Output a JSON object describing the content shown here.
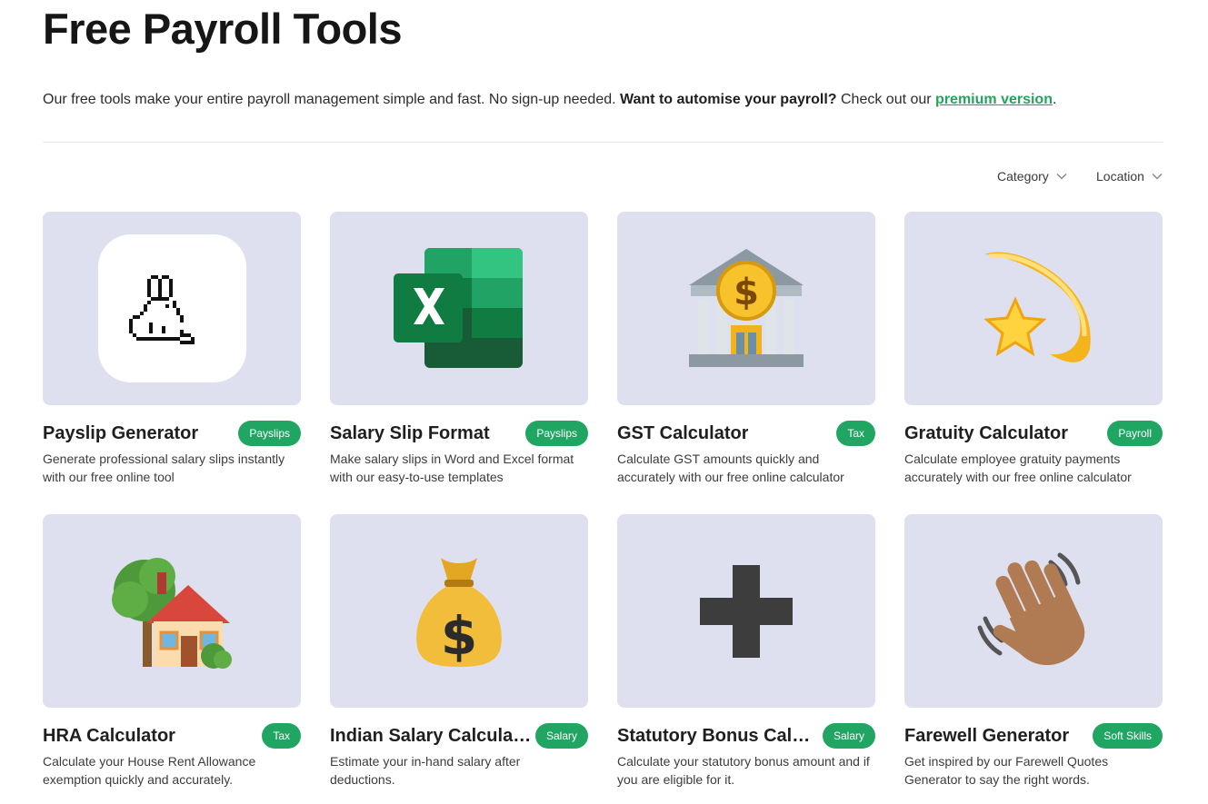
{
  "page": {
    "title": "Free Payroll Tools",
    "intro_text": "Our free tools make your entire payroll management simple and fast. No sign-up needed. ",
    "intro_bold": "Want to automise your payroll?",
    "intro_after": " Check out our ",
    "intro_link": "premium version",
    "intro_end": "."
  },
  "filters": {
    "category": "Category",
    "location": "Location"
  },
  "cards": [
    {
      "title": "Payslip Generator",
      "badge": "Payslips",
      "description": "Generate professional salary slips instantly with our free online tool",
      "icon": "rabbit-icon"
    },
    {
      "title": "Salary Slip Format",
      "badge": "Payslips",
      "description": "Make salary slips in Word and Excel format with our easy-to-use templates",
      "icon": "excel-icon"
    },
    {
      "title": "GST Calculator",
      "badge": "Tax",
      "description": "Calculate GST amounts quickly and accurately with our free online calculator",
      "icon": "bank-icon"
    },
    {
      "title": "Gratuity Calculator",
      "badge": "Payroll",
      "description": "Calculate employee gratuity payments accurately with our free online calculator",
      "icon": "shooting-star-icon"
    },
    {
      "title": "HRA Calculator",
      "badge": "Tax",
      "description": "Calculate your House Rent Allowance exemption quickly and accurately.",
      "icon": "house-icon"
    },
    {
      "title": "Indian Salary Calcula…",
      "badge": "Salary",
      "description": "Estimate your in-hand salary after deductions.",
      "icon": "money-bag-icon"
    },
    {
      "title": "Statutory Bonus Calc…",
      "badge": "Salary",
      "description": "Calculate your statutory bonus amount and if you are eligible for it.",
      "icon": "plus-icon"
    },
    {
      "title": "Farewell Generator",
      "badge": "Soft Skills",
      "description": "Get inspired by our Farewell Quotes Generator to say the right words.",
      "icon": "waving-hand-icon"
    }
  ],
  "colors": {
    "accent": "#21a562",
    "link": "#23a45b",
    "thumb_bg": "#dfe0ef"
  }
}
